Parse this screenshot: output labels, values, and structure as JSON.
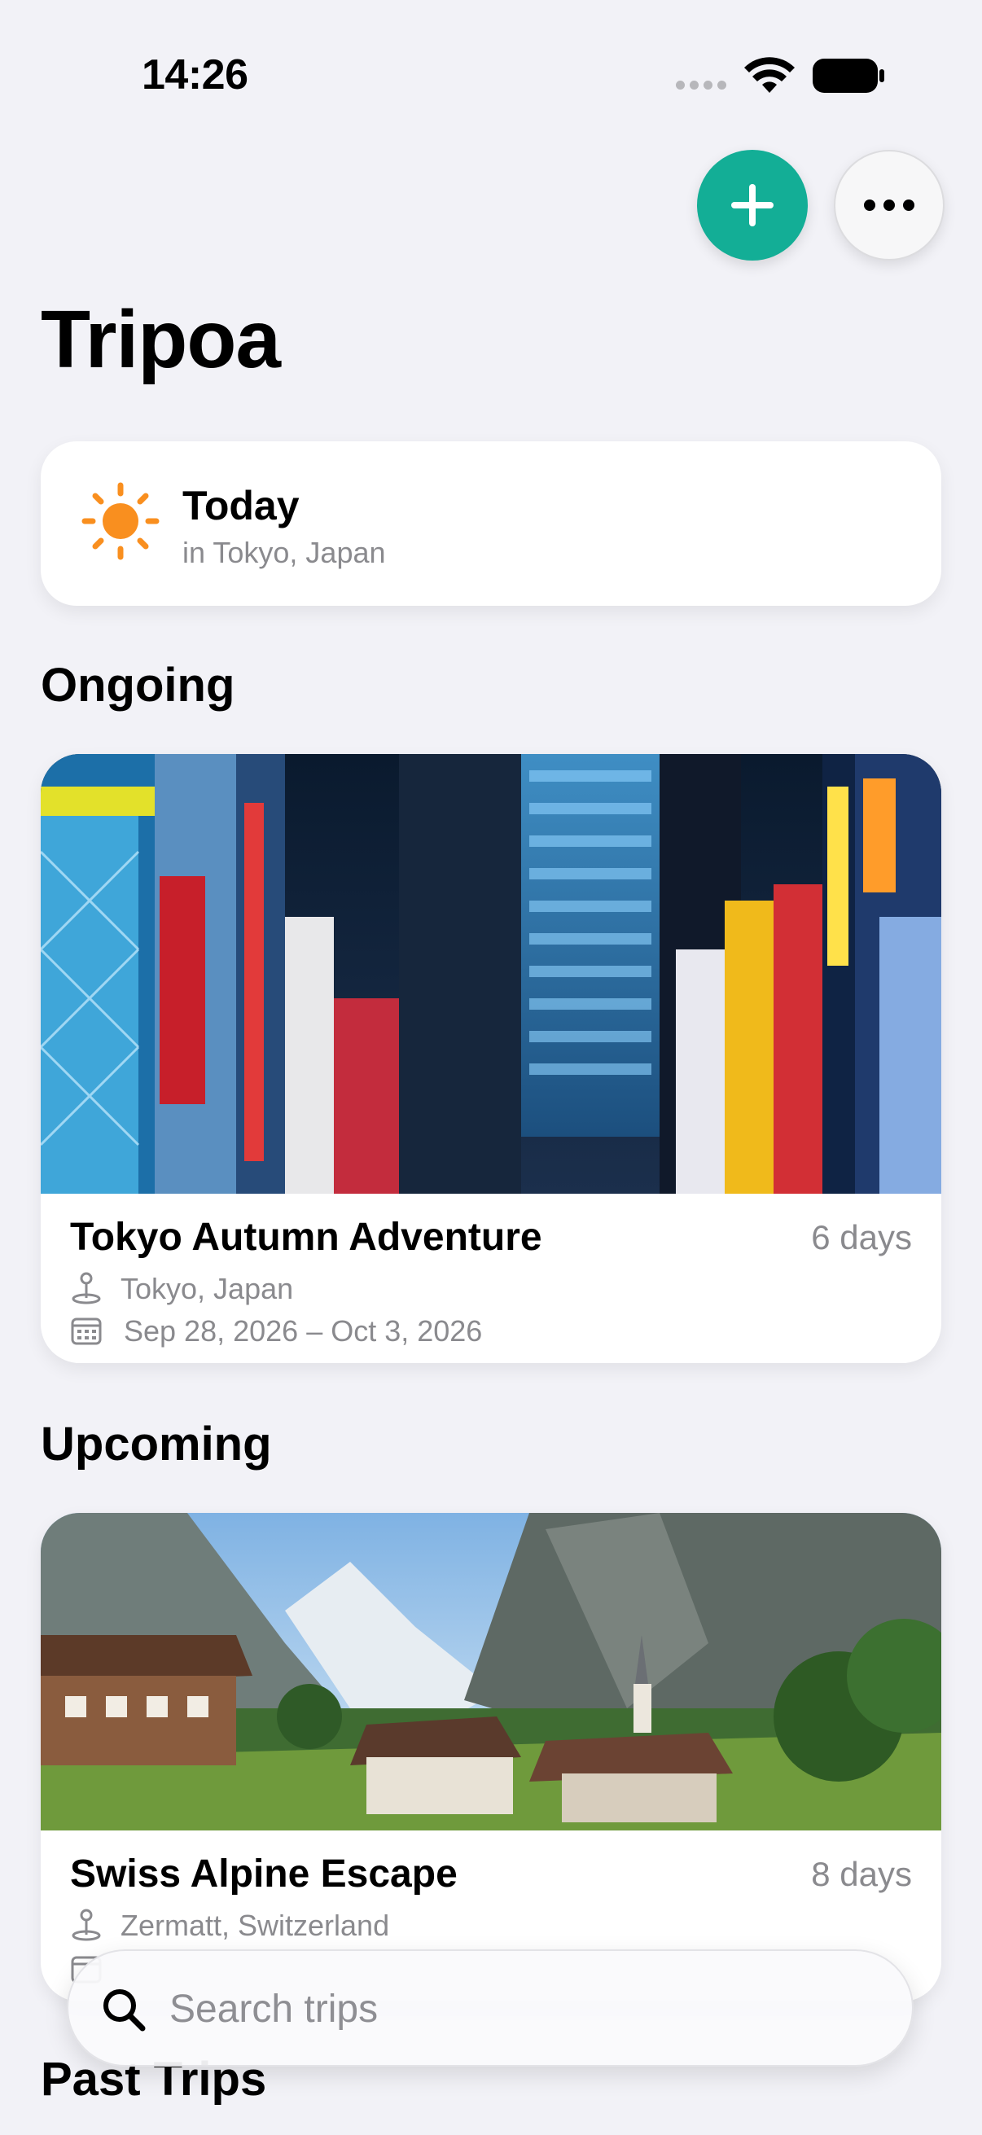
{
  "status_bar": {
    "time": "14:26"
  },
  "header": {
    "add_icon": "plus-icon",
    "more_icon": "ellipsis-icon",
    "title": "Tripoa"
  },
  "today": {
    "icon": "sun-icon",
    "title": "Today",
    "subtitle": "in Tokyo, Japan"
  },
  "sections": {
    "ongoing": "Ongoing",
    "upcoming": "Upcoming",
    "past": "Past Trips"
  },
  "trips": {
    "ongoing": {
      "name": "Tokyo Autumn Adventure",
      "duration": "6 days",
      "location": "Tokyo, Japan",
      "dates": "Sep 28, 2026 – Oct 3, 2026",
      "photo": "Tokyo neon street at night"
    },
    "upcoming": {
      "name": "Swiss Alpine Escape",
      "duration": "8 days",
      "location": "Zermatt, Switzerland",
      "photo": "Alpine valley village"
    }
  },
  "search": {
    "placeholder": "Search trips"
  },
  "colors": {
    "accent": "#13ae96",
    "sun": "#f98f1f",
    "secondary_text": "#8a8a8e",
    "background": "#f2f2f7"
  }
}
